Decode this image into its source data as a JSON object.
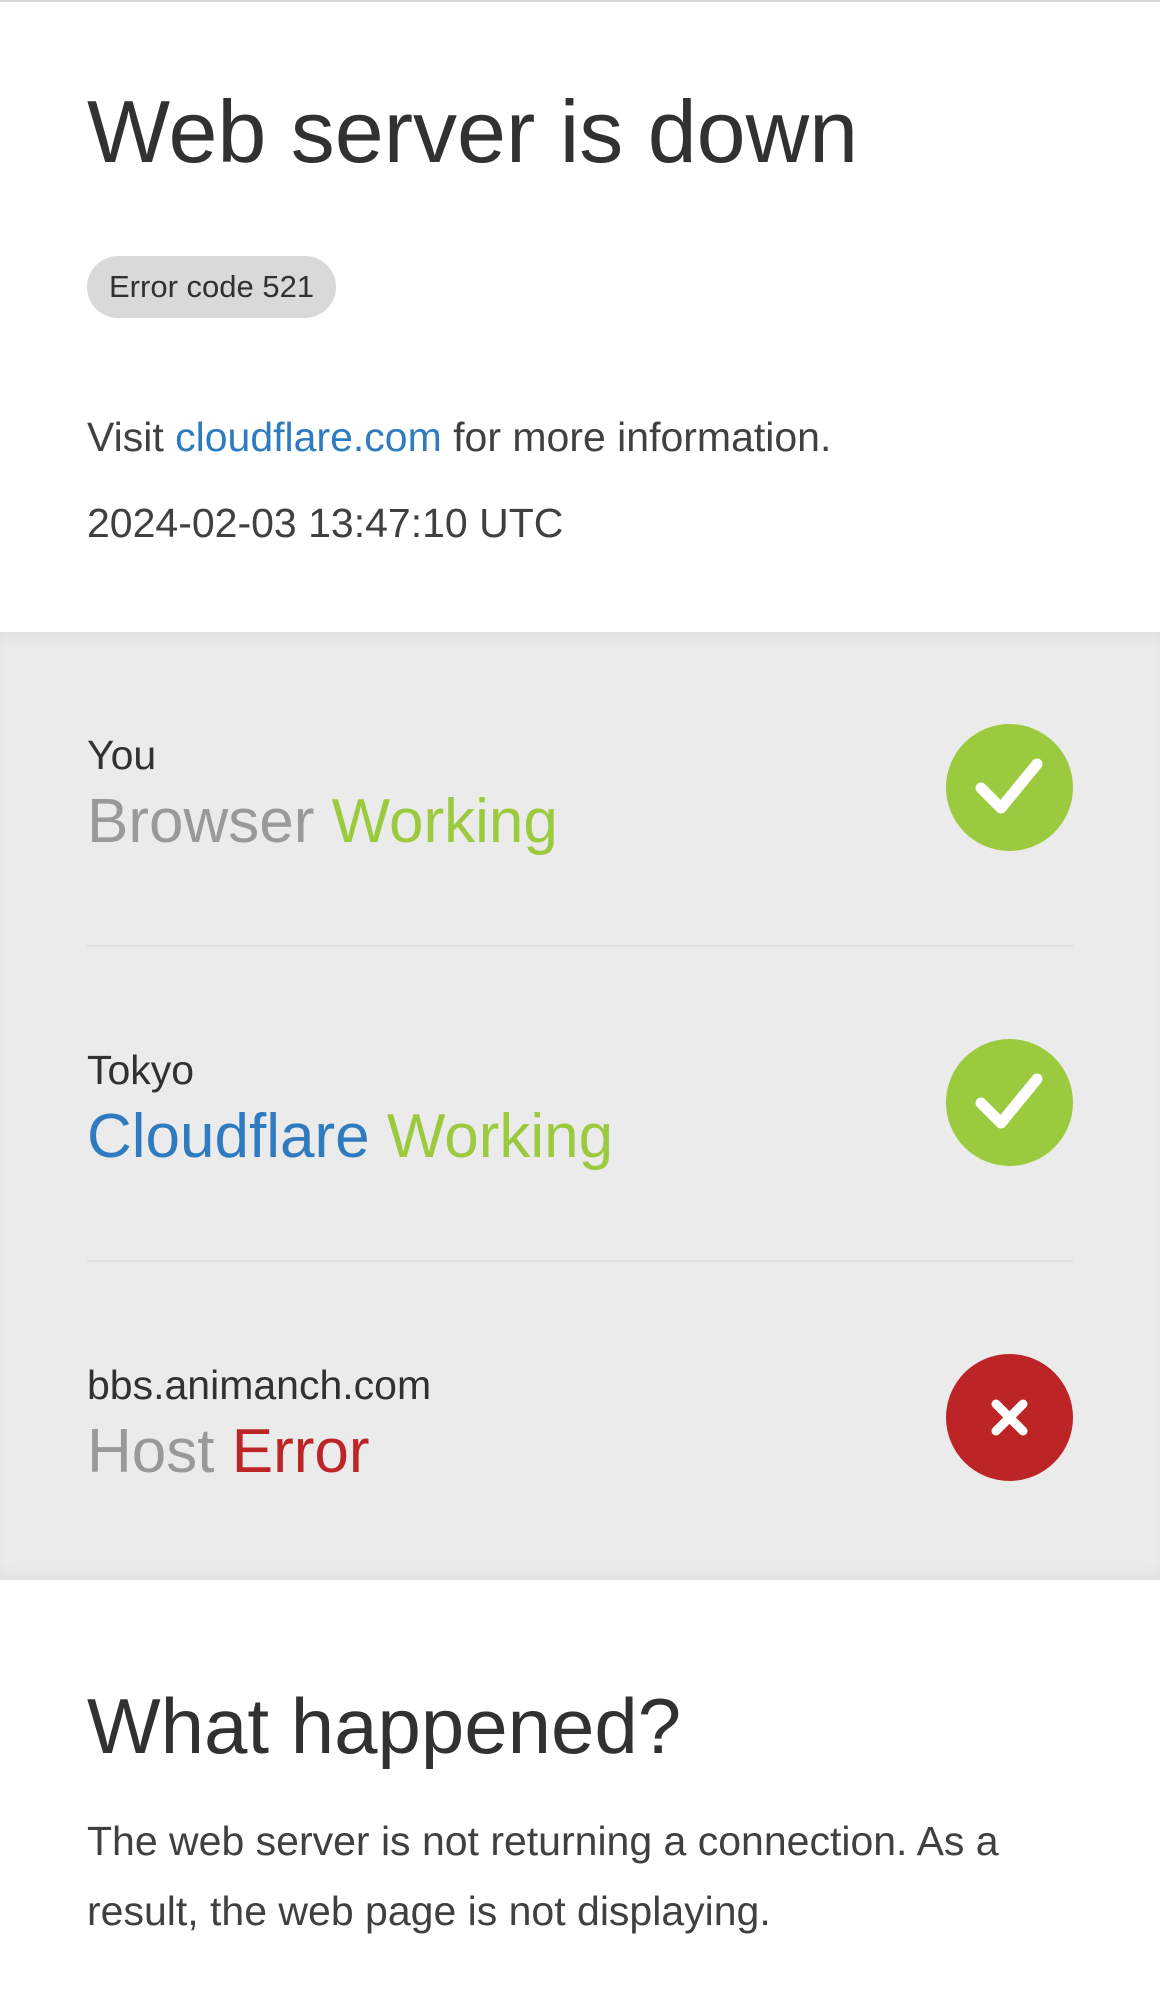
{
  "header": {
    "title": "Web server is down",
    "error_code": "Error code 521",
    "info_prefix": "Visit ",
    "info_link": "cloudflare.com",
    "info_suffix": " for more information.",
    "timestamp": "2024-02-03 13:47:10 UTC"
  },
  "status": {
    "rows": [
      {
        "location": "You",
        "component": "Browser",
        "state": "Working",
        "icon": "check-icon"
      },
      {
        "location": "Tokyo",
        "component": "Cloudflare",
        "state": "Working",
        "icon": "check-icon"
      },
      {
        "location": "bbs.animanch.com",
        "component": "Host",
        "state": "Error",
        "icon": "x-icon"
      }
    ]
  },
  "what_happened": {
    "title": "What happened?",
    "body": "The web server is not returning a connection. As a result, the web page is not displaying."
  },
  "colors": {
    "ok": "#9bca3e",
    "error": "#bd2426",
    "link": "#2f7bbf",
    "status_bg": "#ebebeb"
  }
}
